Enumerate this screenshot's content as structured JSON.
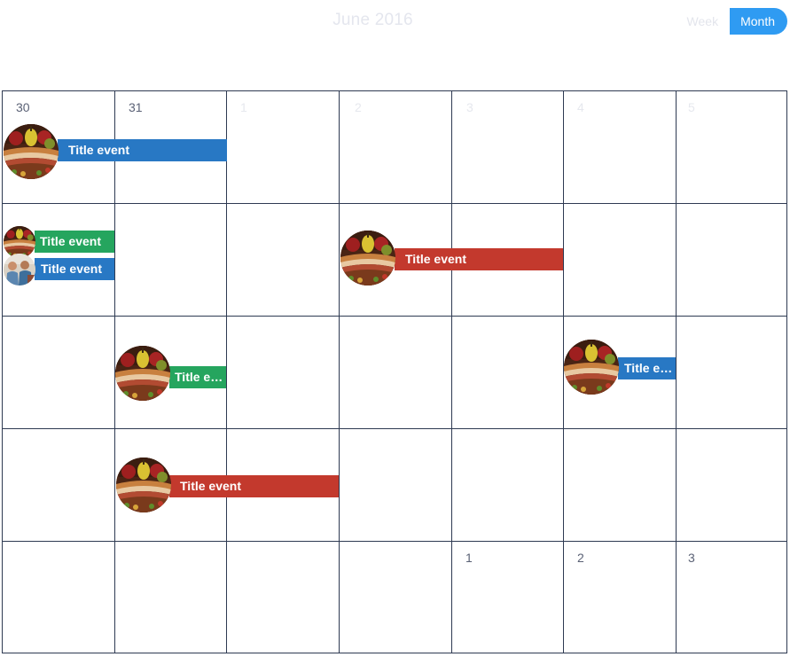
{
  "header": {
    "title": "June 2016",
    "week_label": "Week",
    "month_label": "Month",
    "accent_color": "#2f9bf2"
  },
  "calendar": {
    "weeks": [
      {
        "days": [
          {
            "label": "30",
            "faded": false
          },
          {
            "label": "31",
            "faded": false
          },
          {
            "label": "1",
            "faded": true
          },
          {
            "label": "2",
            "faded": true
          },
          {
            "label": "3",
            "faded": true
          },
          {
            "label": "4",
            "faded": true
          },
          {
            "label": "5",
            "faded": true
          }
        ]
      },
      {
        "days": [
          {
            "label": ""
          },
          {
            "label": ""
          },
          {
            "label": ""
          },
          {
            "label": ""
          },
          {
            "label": ""
          },
          {
            "label": ""
          },
          {
            "label": ""
          }
        ]
      },
      {
        "days": [
          {
            "label": ""
          },
          {
            "label": ""
          },
          {
            "label": ""
          },
          {
            "label": ""
          },
          {
            "label": ""
          },
          {
            "label": ""
          },
          {
            "label": ""
          }
        ]
      },
      {
        "days": [
          {
            "label": ""
          },
          {
            "label": ""
          },
          {
            "label": ""
          },
          {
            "label": ""
          },
          {
            "label": ""
          },
          {
            "label": ""
          },
          {
            "label": ""
          }
        ]
      },
      {
        "days": [
          {
            "label": ""
          },
          {
            "label": ""
          },
          {
            "label": ""
          },
          {
            "label": ""
          },
          {
            "label": "1",
            "faded": false
          },
          {
            "label": "2",
            "faded": false
          },
          {
            "label": "3",
            "faded": false
          }
        ]
      }
    ],
    "event_colors": {
      "blue": "#2878c4",
      "green": "#25a55e",
      "red": "#c3392d"
    }
  },
  "events": [
    {
      "title": "Title event",
      "color": "blue",
      "avatar": "food-photo"
    },
    {
      "title": "Title event",
      "color": "green",
      "avatar": "food-photo-small"
    },
    {
      "title": "Title event",
      "color": "blue",
      "avatar": "people-photo-small"
    },
    {
      "title": "Title event",
      "color": "red",
      "avatar": "food-photo"
    },
    {
      "title": "Title event",
      "color": "green",
      "avatar": "food-photo"
    },
    {
      "title": "Title event",
      "color": "blue",
      "avatar": "food-photo"
    },
    {
      "title": "Title event",
      "color": "red",
      "avatar": "food-photo"
    }
  ]
}
